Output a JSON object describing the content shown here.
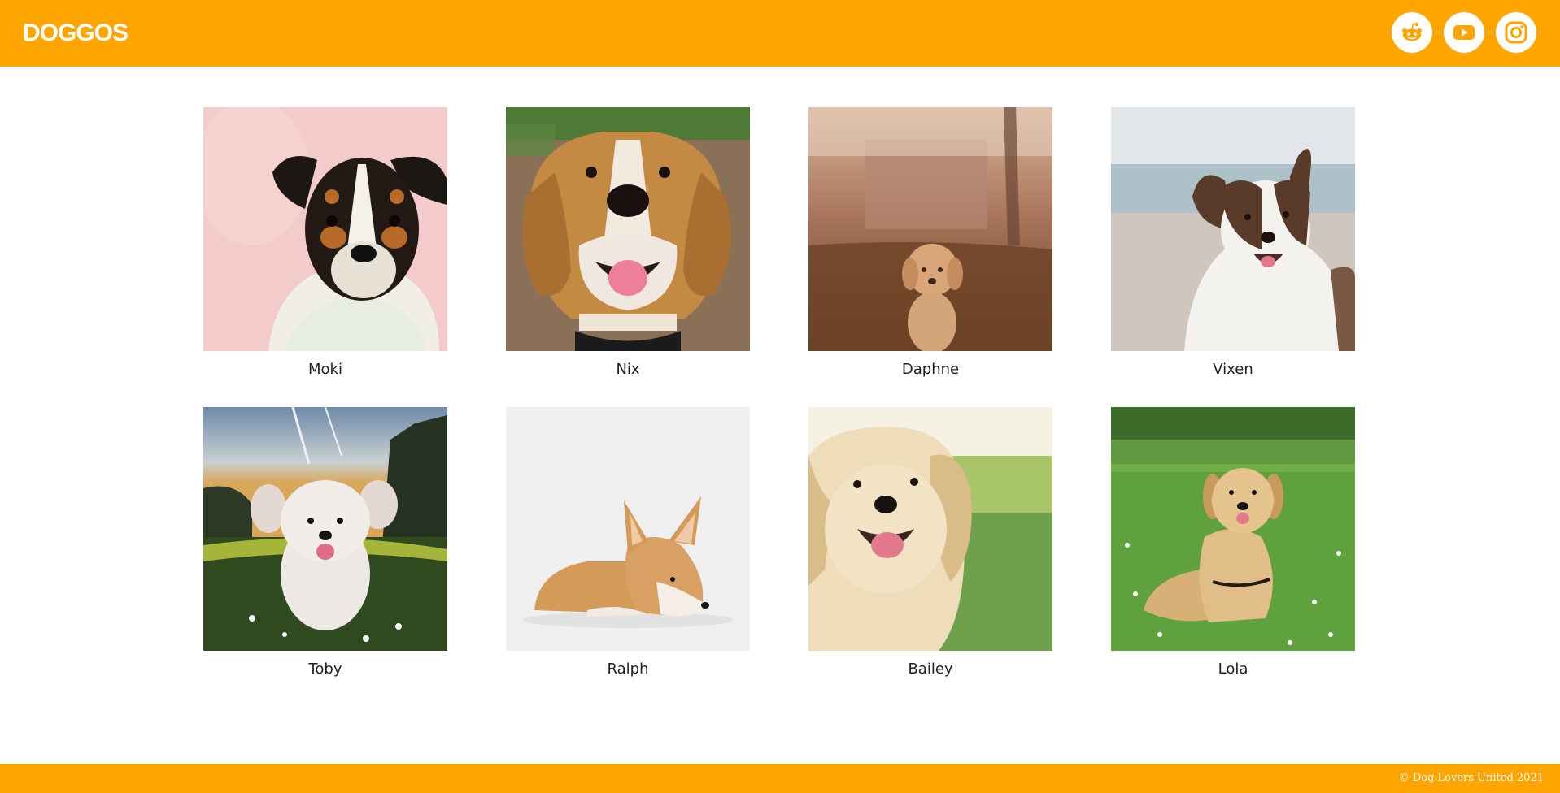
{
  "colors": {
    "brand": "#FFA500",
    "background": "#FFFFFF",
    "text": "#1F1F1F"
  },
  "header": {
    "logo": "DOGGOS",
    "social": [
      {
        "icon": "reddit-icon"
      },
      {
        "icon": "youtube-icon"
      },
      {
        "icon": "instagram-icon"
      }
    ]
  },
  "dogs": [
    {
      "name": "Moki"
    },
    {
      "name": "Nix"
    },
    {
      "name": "Daphne"
    },
    {
      "name": "Vixen"
    },
    {
      "name": "Toby"
    },
    {
      "name": "Ralph"
    },
    {
      "name": "Bailey"
    },
    {
      "name": "Lola"
    }
  ],
  "footer": {
    "copyright": "© Dog Lovers United 2021"
  }
}
